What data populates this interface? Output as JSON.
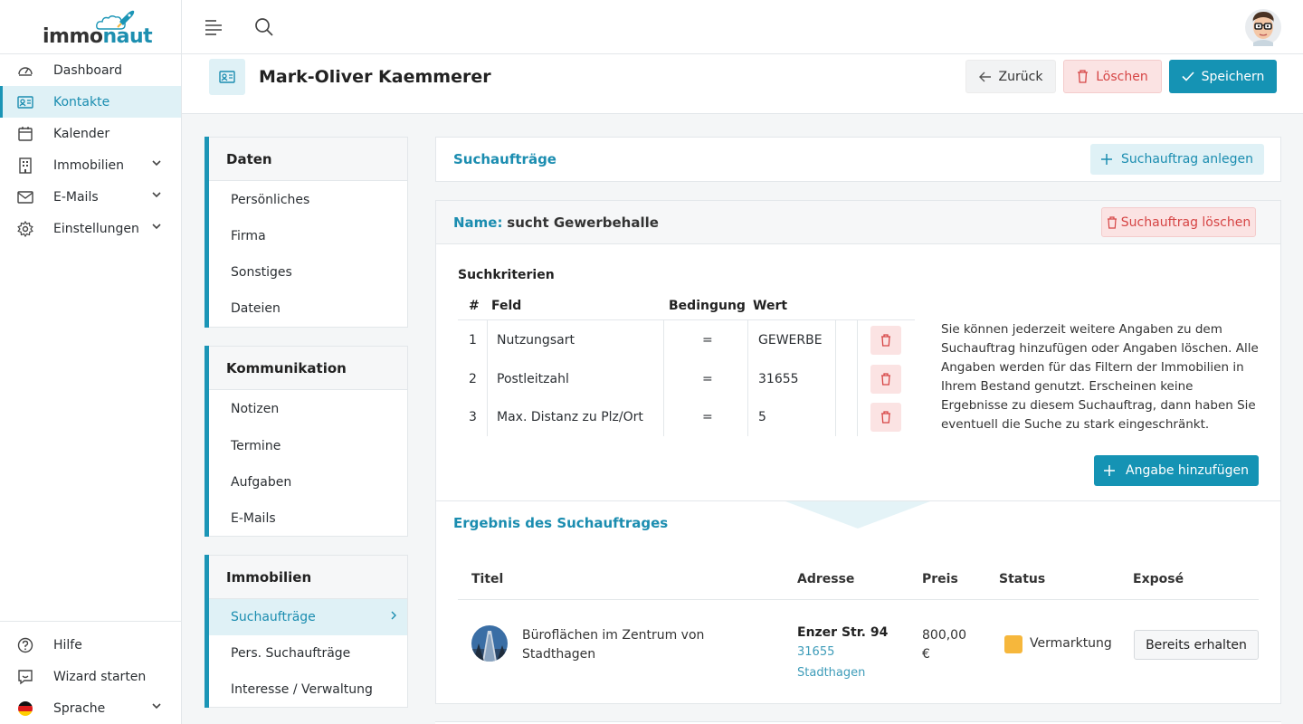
{
  "app": {
    "logo_part1": "immo",
    "logo_part2": "naut"
  },
  "sidebar": {
    "items": [
      {
        "label": "Dashboard",
        "icon": "dashboard-icon"
      },
      {
        "label": "Kontakte",
        "icon": "contacts-icon",
        "active": true
      },
      {
        "label": "Kalender",
        "icon": "calendar-icon"
      },
      {
        "label": "Immobilien",
        "icon": "building-icon",
        "expandable": true
      },
      {
        "label": "E-Mails",
        "icon": "mail-icon",
        "expandable": true
      },
      {
        "label": "Einstellungen",
        "icon": "gear-icon",
        "expandable": true
      }
    ],
    "bottom": [
      {
        "label": "Hilfe",
        "icon": "help-icon"
      },
      {
        "label": "Wizard starten",
        "icon": "wizard-icon"
      },
      {
        "label": "Sprache",
        "icon": "german-flag-icon",
        "expandable": true
      }
    ]
  },
  "header": {
    "title": "Mark-Oliver Kaemmerer",
    "back_label": "Zurück",
    "delete_label": "Löschen",
    "save_label": "Speichern"
  },
  "left_nav": {
    "groups": [
      {
        "title": "Daten",
        "items": [
          "Persönliches",
          "Firma",
          "Sonstiges",
          "Dateien"
        ]
      },
      {
        "title": "Kommunikation",
        "items": [
          "Notizen",
          "Termine",
          "Aufgaben",
          "E-Mails"
        ]
      },
      {
        "title": "Immobilien",
        "items": [
          "Suchaufträge",
          "Pers. Suchaufträge",
          "Interesse / Verwaltung"
        ],
        "active_item": "Suchaufträge"
      }
    ]
  },
  "searches": {
    "title": "Suchaufträge",
    "add_label": "Suchauftrag anlegen",
    "name_prefix": "Name:",
    "name_value": "sucht Gewerbehalle",
    "delete_label": "Suchauftrag löschen",
    "criteria_title": "Suchkriterien",
    "columns": [
      "#",
      "Feld",
      "Bedingung",
      "Wert"
    ],
    "rows": [
      {
        "num": "1",
        "field": "Nutzungsart",
        "cond": "=",
        "value": "GEWERBE"
      },
      {
        "num": "2",
        "field": "Postleitzahl",
        "cond": "=",
        "value": "31655"
      },
      {
        "num": "3",
        "field": "Max. Distanz zu Plz/Ort",
        "cond": "=",
        "value": "5"
      }
    ],
    "help_text": "Sie können jederzeit weitere Angaben zu dem Suchauftrag hinzufügen oder Angaben löschen. Alle Angaben werden für das Filtern der Immobilien in Ihrem Bestand genutzt. Erscheinen keine Ergebnisse zu diesem Suchauftrag, dann haben Sie eventuell die Suche zu stark eingeschränkt.",
    "add_criteria_label": "Angabe hinzufügen",
    "result_title": "Ergebnis des Suchauftrages",
    "result_columns": [
      "Titel",
      "Adresse",
      "Preis",
      "Status",
      "Exposé"
    ],
    "results": [
      {
        "title": "Büroflächen im Zentrum von Stadthagen",
        "street": "Enzer Str. 94",
        "zip": "31655",
        "city": "Stadthagen",
        "price": "800,00 €",
        "status": "Vermarktung",
        "status_color": "#f6b73c",
        "expose_label": "Bereits erhalten"
      }
    ]
  },
  "colors": {
    "accent": "#1593b4",
    "danger": "#d64545",
    "light_accent": "#dff1f6"
  }
}
